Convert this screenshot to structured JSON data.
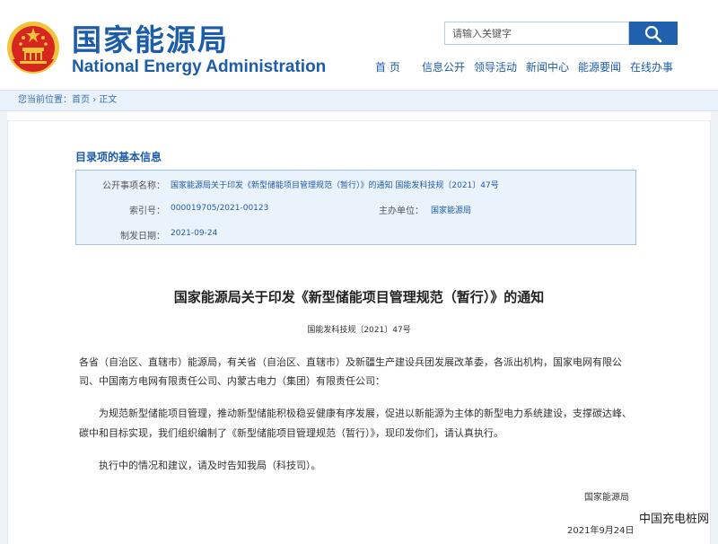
{
  "header": {
    "site_title_cn": "国家能源局",
    "site_title_en": "National Energy Administration",
    "search_placeholder": "请输入关键字",
    "nav": [
      "首 页",
      "信息公开",
      "领导活动",
      "新闻中心",
      "能源要闻",
      "在线办事"
    ]
  },
  "breadcrumb": {
    "prefix": "您当前位置：",
    "home": "首页",
    "sep": " › ",
    "current": "正文"
  },
  "info": {
    "heading": "目录项的基本信息",
    "title_label": "公开事项名称：",
    "title_value": "国家能源局关于印发《新型储能项目管理规范（暂行）》的通知 国能发科技规〔2021〕47号",
    "index_label": "索引号：",
    "index_value": "000019705/2021-00123",
    "org_label": "主办单位：",
    "org_value": "国家能源局",
    "date_label": "制发日期：",
    "date_value": "2021-09-24"
  },
  "document": {
    "title": "国家能源局关于印发《新型储能项目管理规范（暂行）》的通知",
    "number": "国能发科技规〔2021〕47号",
    "para1_line1": "各省（自治区、直辖市）能源局，有关省（自治区、直辖市）及新疆生产建设兵团发展改革委，各派出机构，国家电网有限公",
    "para1_line2": "司、中国南方电网有限责任公司、内蒙古电力（集团）有限责任公司：",
    "para2_line1": "为规范新型储能项目管理，推动新型储能积极稳妥健康有序发展，促进以新能源为主体的新型电力系统建设，支撑碳达峰、",
    "para2_line2": "碳中和目标实现，我们组织编制了《新型储能项目管理规范（暂行）》，现印发你们，请认真执行。",
    "para3": "执行中的情况和建议，请及时告知我局（科技司）。",
    "sign_org": "国家能源局",
    "sign_date": "2021年9月24日"
  },
  "watermark": "中国充电桩网",
  "colors": {
    "brand_blue": "#1d5ca8",
    "search_button": "#1f61ac",
    "info_bg": "#eaf3fb",
    "emblem_red": "#d7261f",
    "emblem_gold": "#f3c43b"
  }
}
